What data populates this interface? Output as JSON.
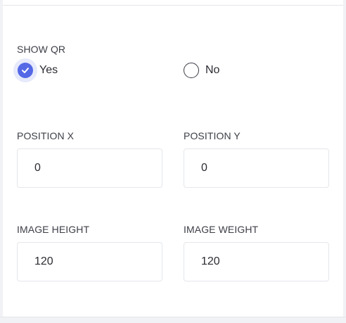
{
  "show_qr": {
    "label": "SHOW QR",
    "options": [
      {
        "label": "Yes",
        "selected": true
      },
      {
        "label": "No",
        "selected": false
      }
    ],
    "accent_color": "#5568e6"
  },
  "position_x": {
    "label": "POSITION X",
    "value": "0"
  },
  "position_y": {
    "label": "POSITION Y",
    "value": "0"
  },
  "image_height": {
    "label": "IMAGE HEIGHT",
    "value": "120"
  },
  "image_weight": {
    "label": "IMAGE WEIGHT",
    "value": "120"
  }
}
